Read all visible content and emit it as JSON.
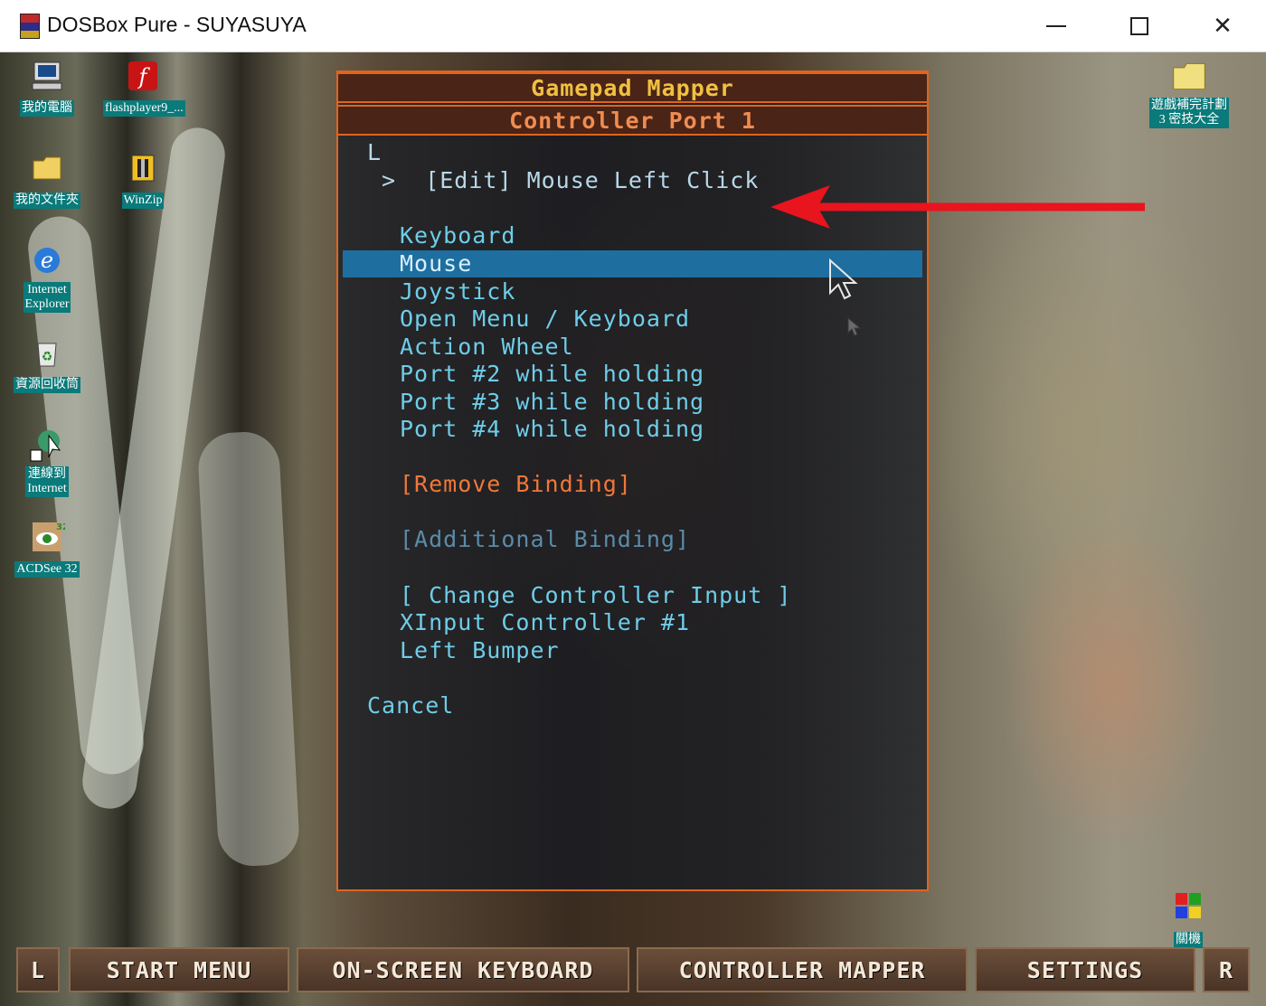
{
  "window": {
    "title": "DOSBox Pure - SUYASUYA",
    "minimize": "minimize",
    "maximize": "maximize",
    "close": "close"
  },
  "desktop": {
    "icons": [
      {
        "label": "我的電腦",
        "icon": "computer-icon"
      },
      {
        "label": "flashplayer9_...",
        "icon": "flash-icon"
      },
      {
        "label": "我的文件夾",
        "icon": "folder-icon"
      },
      {
        "label": "WinZip",
        "icon": "winzip-icon"
      },
      {
        "label": "Internet\nExplorer",
        "icon": "ie-icon"
      },
      {
        "label": "資源回收筒",
        "icon": "recycle-bin-icon"
      },
      {
        "label": "連線到\nInternet",
        "icon": "connect-icon"
      },
      {
        "label": "ACDSee 32",
        "icon": "acdsee-icon"
      },
      {
        "label": "遊戲補完計劃\n3 密技大全",
        "icon": "folder-icon"
      },
      {
        "label": "關機",
        "icon": "windows-logo-icon"
      }
    ]
  },
  "mapper": {
    "title": "Gamepad Mapper",
    "port": "Controller Port 1",
    "button": "L",
    "current": " >  [Edit] Mouse Left Click",
    "options": [
      "Keyboard",
      "Mouse",
      "Joystick",
      "Open Menu / Keyboard",
      "Action Wheel",
      "Port #2 while holding",
      "Port #3 while holding",
      "Port #4 while holding"
    ],
    "selected_index": 1,
    "remove": "[Remove Binding]",
    "additional": "[Additional Binding]",
    "change_input": "[ Change Controller Input ]",
    "controller": "XInput Controller #1",
    "bumper": "Left Bumper",
    "cancel": "Cancel"
  },
  "bottom_bar": {
    "left": "L",
    "start_menu": "START MENU",
    "osk": "ON-SCREEN KEYBOARD",
    "controller_mapper": "CONTROLLER MAPPER",
    "settings": "SETTINGS",
    "right": "R"
  },
  "colors": {
    "accent": "#e0641e",
    "title": "#f0c040",
    "option": "#6ecde8",
    "selected": "#1e6ea0",
    "remove": "#f07838",
    "arrow": "#e8141e"
  }
}
